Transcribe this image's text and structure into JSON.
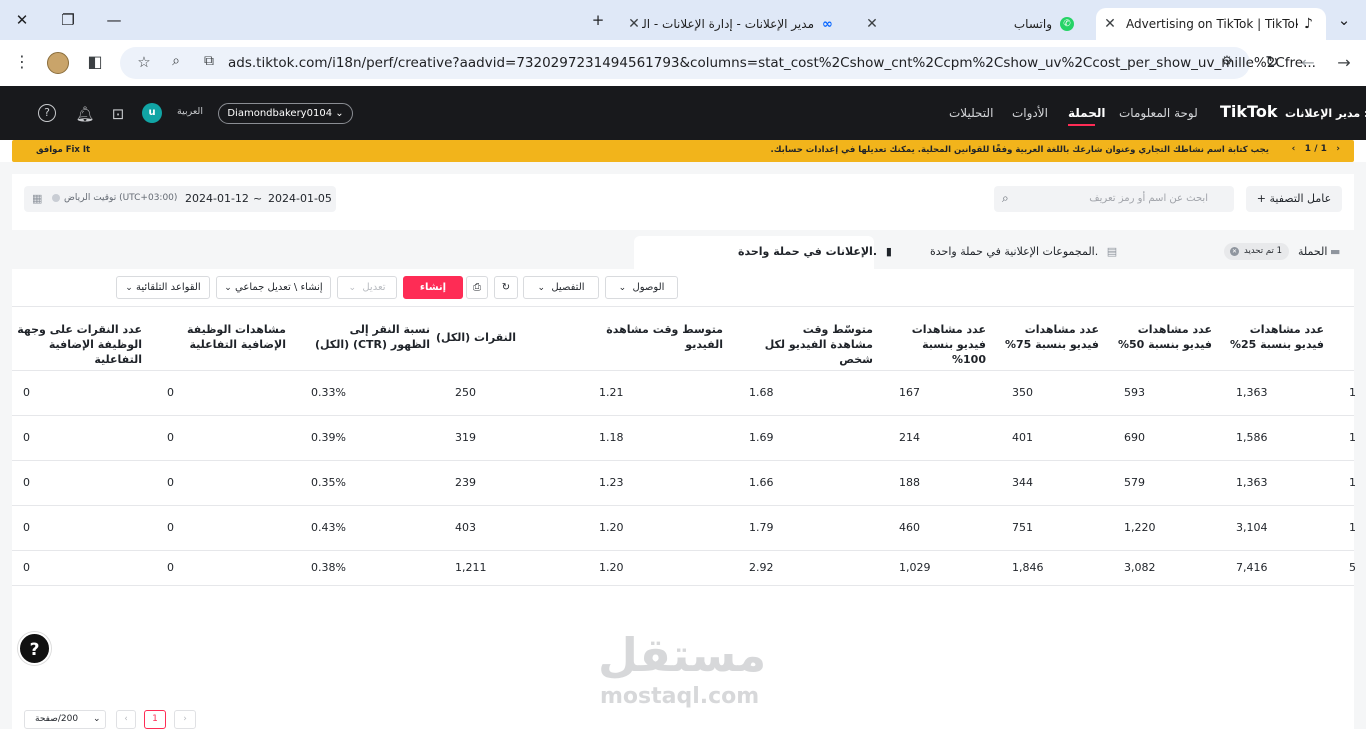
{
  "browser": {
    "tabs": [
      {
        "title": "Advertising on TikTok | TikTok A",
        "active": true
      },
      {
        "title": "واتساب",
        "active": false
      },
      {
        "title": "مدير الإعلانات - إدارة الإعلانات - الـ",
        "active": false
      }
    ],
    "url": "ads.tiktok.com/i18n/perf/creative?aadvid=7320297231494561793&columns=stat_cost%2Cshow_cnt%2Ccpm%2Cshow_uv%2Ccost_per_show_uv_mille%2Cfre..."
  },
  "app": {
    "logo": "TikTok",
    "logo_suffix": "مدير الإعلانات :",
    "nav": [
      "لوحة المعلومات",
      "الحملة",
      "الأدوات",
      "التحليلات"
    ],
    "nav_selected": "الحملة",
    "account": "Diamondbakery0104",
    "language": "العربية",
    "avatar_letter": "u"
  },
  "banner": {
    "message": "يجب كتابة اسم نشاطك التجاري وعنوان شارعك باللغة العربية وفقًا للقوانين المحلية. يمكنك تعديلها في إعدادات حسابك.",
    "action": "موافق Fix It",
    "pager": "1 / 1"
  },
  "filters": {
    "date_start": "2024-01-05",
    "date_sep": "~",
    "date_end": "2024-01-12",
    "timezone": "(UTC+03:00) توقيت الرياض",
    "search_placeholder": "ابحث عن اسم أو رمز تعريف",
    "filter_button": "+ عامل التصفية"
  },
  "levels": {
    "campaign": "الحملة",
    "selected_badge": "1 تم تحديد",
    "adgroups": "المجموعات الإعلانية في حملة واحدة.",
    "ads": "الإعلانات في حملة واحدة."
  },
  "toolbar": {
    "create": "إنشاء",
    "edit": "تعديل",
    "bulk": "إنشاء \\ تعديل جماعي",
    "rules": "القواعد التلقائية",
    "breakdown": "التفصيل",
    "reach": "الوصول"
  },
  "table": {
    "headers": [
      "عدد مشاهدات فيديو بنسبة 25%",
      "عدد مشاهدات فيديو بنسبة 50%",
      "عدد مشاهدات فيديو بنسبة 75%",
      "عدد مشاهدات فيديو بنسبة 100%",
      "متوسّط وقت مشاهدة الفيديو لكل شخص",
      "متوسط وقت مشاهدة الفيديو",
      "النقرات (الكل)",
      "نسبة النقر إلى الظهور (CTR) (الكل)",
      "مشاهدات الوظيفة الإضافية التفاعلية",
      "عدد النقرات على وجهة الوظيفة الإضافية التفاعلية"
    ],
    "rows": [
      {
        "lead": "1",
        "c": [
          "1,363",
          "593",
          "350",
          "167",
          "1.68",
          "1.21",
          "250",
          "0.33%",
          "0",
          "0"
        ]
      },
      {
        "lead": "1",
        "c": [
          "1,586",
          "690",
          "401",
          "214",
          "1.69",
          "1.18",
          "319",
          "0.39%",
          "0",
          "0"
        ]
      },
      {
        "lead": "1",
        "c": [
          "1,363",
          "579",
          "344",
          "188",
          "1.66",
          "1.23",
          "239",
          "0.35%",
          "0",
          "0"
        ]
      },
      {
        "lead": "1",
        "c": [
          "3,104",
          "1,220",
          "751",
          "460",
          "1.79",
          "1.20",
          "403",
          "0.43%",
          "0",
          "0"
        ]
      },
      {
        "lead": "5",
        "c": [
          "7,416",
          "3,082",
          "1,846",
          "1,029",
          "2.92",
          "1.20",
          "1,211",
          "0.38%",
          "0",
          "0"
        ]
      }
    ]
  },
  "pagination": {
    "page_size": "200/صفحة",
    "current_page": "1"
  },
  "watermark": {
    "arabic": "مستقل",
    "latin": "mostaql.com"
  }
}
